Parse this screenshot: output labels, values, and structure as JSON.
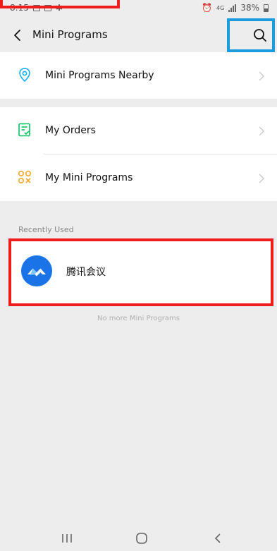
{
  "status_bar": {
    "time": "8:15",
    "dots": "···",
    "network": "4G",
    "battery": "38%"
  },
  "nav": {
    "title": "Mini Programs"
  },
  "menu": {
    "items": [
      {
        "label": "Mini Programs Nearby",
        "icon": "location-pin-icon"
      },
      {
        "label": "My Orders",
        "icon": "order-list-icon"
      },
      {
        "label": "My Mini Programs",
        "icon": "mini-program-grid-icon"
      }
    ]
  },
  "recent": {
    "header": "Recently Used",
    "items": [
      {
        "name": "腾讯会议",
        "icon": "tencent-meeting-logo"
      }
    ]
  },
  "footer": {
    "note": "No more Mini Programs"
  },
  "colors": {
    "accent_green": "#07c160",
    "location_blue": "#10aeff",
    "grid_yellow": "#f5a623",
    "highlight_red": "#ef1c1c",
    "highlight_blue": "#1b9be0",
    "logo_blue": "#1a74e8"
  }
}
